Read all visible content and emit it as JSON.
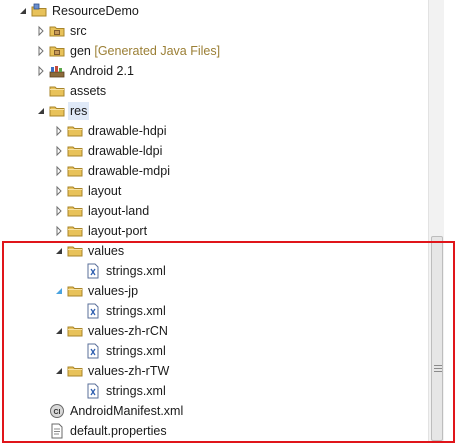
{
  "tree": {
    "nodes": [
      {
        "name": "tree-node-project-resourcedemo",
        "label": "ResourceDemo",
        "depth": 0,
        "twisty": "expanded",
        "icon": "project-icon"
      },
      {
        "name": "tree-node-src",
        "label": "src",
        "depth": 1,
        "twisty": "collapsed",
        "icon": "source-folder-icon"
      },
      {
        "name": "tree-node-gen",
        "label": "gen",
        "decoration": "[Generated Java Files]",
        "depth": 1,
        "twisty": "collapsed",
        "icon": "source-folder-icon"
      },
      {
        "name": "tree-node-android-2-1",
        "label": "Android 2.1",
        "depth": 1,
        "twisty": "collapsed",
        "icon": "library-icon"
      },
      {
        "name": "tree-node-assets",
        "label": "assets",
        "depth": 1,
        "twisty": "none",
        "icon": "folder-icon"
      },
      {
        "name": "tree-node-res",
        "label": "res",
        "depth": 1,
        "twisty": "expanded",
        "icon": "folder-icon",
        "selected": true
      },
      {
        "name": "tree-node-drawable-hdpi",
        "label": "drawable-hdpi",
        "depth": 2,
        "twisty": "collapsed",
        "icon": "folder-icon"
      },
      {
        "name": "tree-node-drawable-ldpi",
        "label": "drawable-ldpi",
        "depth": 2,
        "twisty": "collapsed",
        "icon": "folder-icon"
      },
      {
        "name": "tree-node-drawable-mdpi",
        "label": "drawable-mdpi",
        "depth": 2,
        "twisty": "collapsed",
        "icon": "folder-icon"
      },
      {
        "name": "tree-node-layout",
        "label": "layout",
        "depth": 2,
        "twisty": "collapsed",
        "icon": "folder-icon"
      },
      {
        "name": "tree-node-layout-land",
        "label": "layout-land",
        "depth": 2,
        "twisty": "collapsed",
        "icon": "folder-icon"
      },
      {
        "name": "tree-node-layout-port",
        "label": "layout-port",
        "depth": 2,
        "twisty": "collapsed",
        "icon": "folder-icon"
      },
      {
        "name": "tree-node-values",
        "label": "values",
        "depth": 2,
        "twisty": "expanded",
        "icon": "folder-icon"
      },
      {
        "name": "tree-node-values-strings-xml",
        "label": "strings.xml",
        "depth": 3,
        "twisty": "none",
        "icon": "xml-file-icon"
      },
      {
        "name": "tree-node-values-jp",
        "label": "values-jp",
        "depth": 2,
        "twisty": "expanded-hover",
        "icon": "folder-icon"
      },
      {
        "name": "tree-node-values-jp-strings-xml",
        "label": "strings.xml",
        "depth": 3,
        "twisty": "none",
        "icon": "xml-file-icon"
      },
      {
        "name": "tree-node-values-zh-rcn",
        "label": "values-zh-rCN",
        "depth": 2,
        "twisty": "expanded",
        "icon": "folder-icon"
      },
      {
        "name": "tree-node-values-zh-rcn-strings-xml",
        "label": "strings.xml",
        "depth": 3,
        "twisty": "none",
        "icon": "xml-file-icon"
      },
      {
        "name": "tree-node-values-zh-rtw",
        "label": "values-zh-rTW",
        "depth": 2,
        "twisty": "expanded",
        "icon": "folder-icon"
      },
      {
        "name": "tree-node-values-zh-rtw-strings-xml",
        "label": "strings.xml",
        "depth": 3,
        "twisty": "none",
        "icon": "xml-file-icon"
      },
      {
        "name": "tree-node-androidmanifest-xml",
        "label": "AndroidManifest.xml",
        "depth": 1,
        "twisty": "none",
        "icon": "manifest-file-icon"
      },
      {
        "name": "tree-node-default-properties",
        "label": "default.properties",
        "depth": 1,
        "twisty": "none",
        "icon": "text-file-icon"
      }
    ]
  },
  "colors": {
    "selection": "#dfe9f7",
    "highlight_border": "#e0151a",
    "folder": "#e8c25a",
    "decoration_text": "#9b7f35"
  }
}
